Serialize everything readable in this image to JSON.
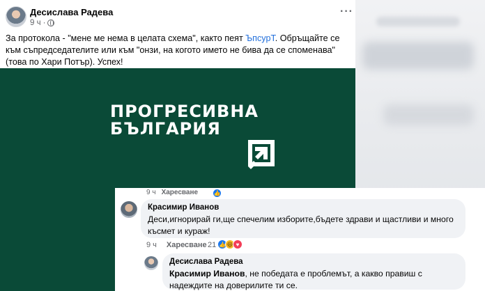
{
  "post": {
    "author": "Десислава Радева",
    "time": "9 ч",
    "more_label": "···",
    "text_before": "За протокола - \"мене ме нема в целата схема\", както пеят ",
    "mention": "ЪпсурТ",
    "text_after": ". Обръщайте се към съпредседателите или към \"онзи, на когото името не бива да се споменава\" (това по Хари Потър). Успех!"
  },
  "image": {
    "logo_line1": "ПРОГРЕСИВНА",
    "logo_line2": "БЪЛГАРИЯ",
    "bg_color": "#0a4a37"
  },
  "previous_comment_actions": {
    "time": "9 ч",
    "like_label": "Харесване"
  },
  "comments": [
    {
      "author": "Красимир Иванов",
      "text": "Деси,игнорирай ги,ще спечелим изборите,бъдете здрави и щастливи и много късмет и кураж!",
      "time": "9 ч",
      "like_label": "Харесване",
      "reaction_count": "21",
      "reactions": [
        "like",
        "haha",
        "love"
      ]
    },
    {
      "author": "Десислава Радева",
      "mention": "Красимир Иванов",
      "text": ", не победата е проблемът, а какво правиш с надеждите на доверилите ти се."
    }
  ]
}
